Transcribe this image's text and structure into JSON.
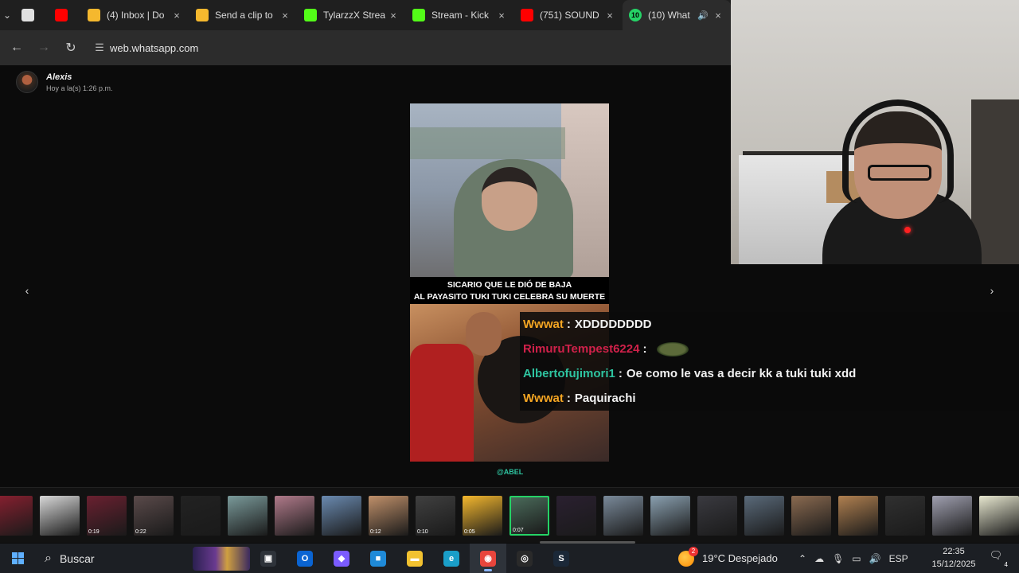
{
  "browser": {
    "tabs": [
      {
        "title": "",
        "favicon": "openai-icon",
        "color": "#e0e0e0",
        "kind": "pinned"
      },
      {
        "title": "",
        "favicon": "youtube-icon",
        "color": "#ff0000",
        "kind": "pinned"
      },
      {
        "title": "(4) Inbox | Do",
        "favicon": "streamer-tool-icon",
        "color": "#f5b82e"
      },
      {
        "title": "Send a clip to",
        "favicon": "streamer-tool-icon",
        "color": "#f5b82e"
      },
      {
        "title": "TylarzzX Strea",
        "favicon": "kick-icon",
        "color": "#53fc18"
      },
      {
        "title": "Stream - Kick",
        "favicon": "kick-icon",
        "color": "#53fc18"
      },
      {
        "title": "(751) SOUND",
        "favicon": "youtube-icon",
        "color": "#ff0000"
      },
      {
        "title": "(10) What",
        "favicon": "whatsapp-icon",
        "color": "#25d366",
        "badge": "10"
      }
    ],
    "url": "web.whatsapp.com"
  },
  "viewer": {
    "sender_name": "Alexis",
    "sender_time": "Hoy a la(s) 1:26 p.m.",
    "video_caption_1": "SICARIO QUE LE DIÓ DE BAJA",
    "video_caption_2": "AL PAYASITO TUKI TUKI CELEBRA SU MUERTE",
    "watermark": "@ABEL"
  },
  "chat": [
    {
      "user": "Wwwat",
      "user_color": "#f5a623",
      "message": "XDDDDDDDD"
    },
    {
      "user": "RimuruTempest6224",
      "user_color": "#d0214a",
      "message": "",
      "emote": "turtle-emote-icon"
    },
    {
      "user": "Albertofujimori1",
      "user_color": "#2ec4a0",
      "message": "Oe como le vas a decir kk a tuki tuki xdd"
    },
    {
      "user": "Wwwat",
      "user_color": "#f5a623",
      "message": "Paquirachi"
    }
  ],
  "thumbnails": [
    {
      "color": "#8a2030",
      "duration": ""
    },
    {
      "color": "#d8d8d8",
      "duration": ""
    },
    {
      "color": "#6a2030",
      "duration": "0:19"
    },
    {
      "color": "#5a4a4a",
      "duration": "0:22"
    },
    {
      "color": "#222222",
      "duration": ""
    },
    {
      "color": "#7a9a9a",
      "duration": ""
    },
    {
      "color": "#b07a8a",
      "duration": ""
    },
    {
      "color": "#6a8ab0",
      "duration": ""
    },
    {
      "color": "#c0906a",
      "duration": "0:12"
    },
    {
      "color": "#404040",
      "duration": "0:10"
    },
    {
      "color": "#f5b82e",
      "duration": "0:05"
    },
    {
      "color": "#4a6a5a",
      "duration": "0:07",
      "selected": true
    },
    {
      "color": "#2a2030",
      "duration": ""
    },
    {
      "color": "#7a8a9a",
      "duration": ""
    },
    {
      "color": "#8aa0b0",
      "duration": ""
    },
    {
      "color": "#3a3a40",
      "duration": ""
    },
    {
      "color": "#5a6a7a",
      "duration": ""
    },
    {
      "color": "#8a6a50",
      "duration": ""
    },
    {
      "color": "#b08050",
      "duration": ""
    },
    {
      "color": "#303030",
      "duration": ""
    },
    {
      "color": "#a0a0b0",
      "duration": ""
    },
    {
      "color": "#e8e8d0",
      "duration": ""
    }
  ],
  "taskbar": {
    "search_label": "Buscar",
    "apps": [
      {
        "name": "task-view-icon",
        "glyph": "▣",
        "color": "#2e333a"
      },
      {
        "name": "outlook-icon",
        "glyph": "O",
        "color": "#0a64d2"
      },
      {
        "name": "copilot-icon",
        "glyph": "◆",
        "color": "#7b5cff"
      },
      {
        "name": "store-icon",
        "glyph": "■",
        "color": "#1f8ad8"
      },
      {
        "name": "file-explorer-icon",
        "glyph": "▬",
        "color": "#f2c230"
      },
      {
        "name": "edge-icon",
        "glyph": "e",
        "color": "#1a9ec8"
      },
      {
        "name": "chrome-icon",
        "glyph": "◉",
        "color": "#e8453c",
        "active": true
      },
      {
        "name": "obs-icon",
        "glyph": "◎",
        "color": "#2a2a2a"
      },
      {
        "name": "steam-icon",
        "glyph": "S",
        "color": "#1b2838"
      }
    ],
    "weather_badge": "2",
    "weather_text": "19°C  Despejado",
    "language": "ESP",
    "time": "22:35",
    "date": "15/12/2025",
    "notif_count": "4"
  }
}
